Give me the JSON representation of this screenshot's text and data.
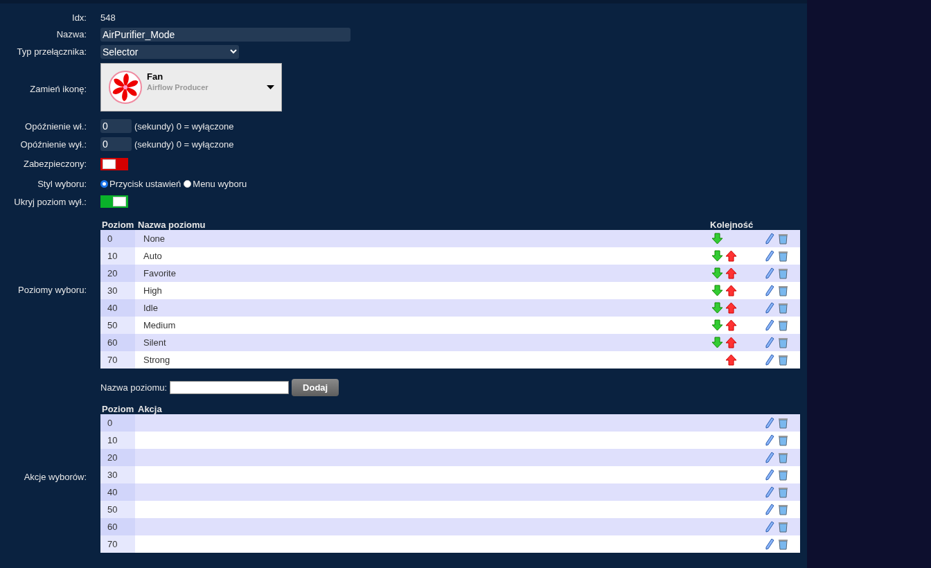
{
  "form": {
    "idx": {
      "label": "Idx:",
      "value": "548"
    },
    "name": {
      "label": "Nazwa:",
      "value": "AirPurifier_Mode"
    },
    "switch_type": {
      "label": "Typ przełącznika:",
      "value": "Selector"
    },
    "icon": {
      "label": "Zamień ikonę:",
      "title": "Fan",
      "subtitle": "Airflow Producer"
    },
    "on_delay": {
      "label": "Opóźnienie wł.:",
      "value": "0",
      "hint": "(sekundy) 0 = wyłączone"
    },
    "off_delay": {
      "label": "Opóźnienie wył.:",
      "value": "0",
      "hint": "(sekundy) 0 = wyłączone"
    },
    "protected": {
      "label": "Zabezpieczony:",
      "on": false
    },
    "selector_style": {
      "label": "Styl wyboru:",
      "options": [
        {
          "label": "Przycisk ustawień",
          "selected": true
        },
        {
          "label": "Menu wyboru",
          "selected": false
        }
      ]
    },
    "hide_off_level": {
      "label": "Ukryj poziom wył.:",
      "on": true
    }
  },
  "levels": {
    "label": "Poziomy wyboru:",
    "columns": [
      "Poziom",
      "Nazwa poziomu",
      "Kolejność"
    ],
    "rows": [
      {
        "level": "0",
        "name": "None",
        "can_move_down": true,
        "can_move_up": false
      },
      {
        "level": "10",
        "name": "Auto",
        "can_move_down": true,
        "can_move_up": true
      },
      {
        "level": "20",
        "name": "Favorite",
        "can_move_down": true,
        "can_move_up": true
      },
      {
        "level": "30",
        "name": "High",
        "can_move_down": true,
        "can_move_up": true
      },
      {
        "level": "40",
        "name": "Idle",
        "can_move_down": true,
        "can_move_up": true
      },
      {
        "level": "50",
        "name": "Medium",
        "can_move_down": true,
        "can_move_up": true
      },
      {
        "level": "60",
        "name": "Silent",
        "can_move_down": true,
        "can_move_up": true
      },
      {
        "level": "70",
        "name": "Strong",
        "can_move_down": false,
        "can_move_up": true
      }
    ]
  },
  "add_level": {
    "label": "Nazwa poziomu:",
    "button": "Dodaj"
  },
  "actions": {
    "label": "Akcje wyborów:",
    "columns": [
      "Poziom",
      "Akcja"
    ],
    "rows": [
      {
        "level": "0"
      },
      {
        "level": "10"
      },
      {
        "level": "20"
      },
      {
        "level": "30"
      },
      {
        "level": "40"
      },
      {
        "level": "50"
      },
      {
        "level": "60"
      },
      {
        "level": "70"
      }
    ]
  }
}
